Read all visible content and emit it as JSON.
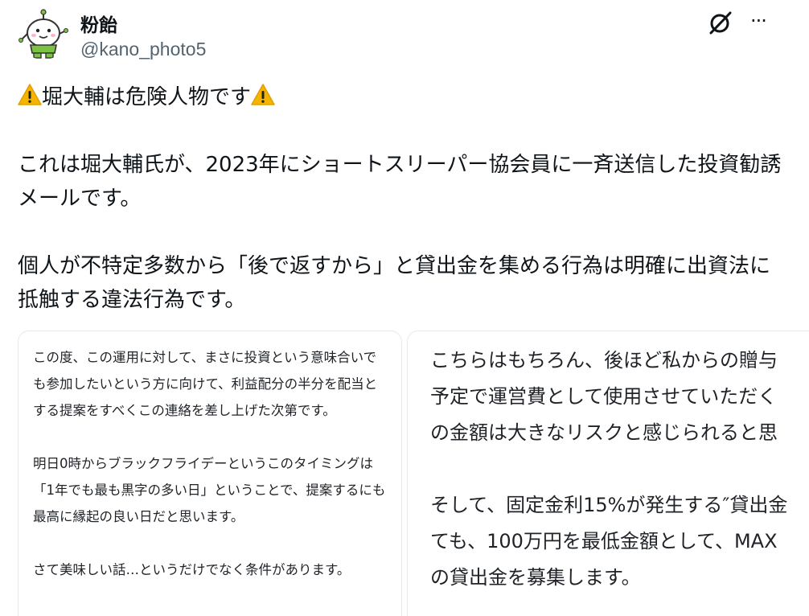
{
  "user": {
    "display_name": "粉飴",
    "handle": "@kano_photo5"
  },
  "actions": {
    "grok_icon": "grok-icon",
    "more_icon": "more-icon",
    "more_glyph": "···"
  },
  "tweet": {
    "line1": "堀大輔は危険人物です",
    "para2": "これは堀大輔氏が、2023年にショートスリーパー協会員に一斉送信した投資勧誘メールです。",
    "para3": "個人が不特定多数から「後で返すから」と貸出金を集める行為は明確に出資法に抵触する違法行為です。"
  },
  "image_left": {
    "p1": "この度、この運用に対して、まさに投資という意味合いでも参加したいという方に向けて、利益配分の半分を配当とする提案をすべくこの連絡を差し上げた次第です。",
    "p2": "明日0時からブラックフライデーというこのタイミングは「1年でも最も黒字の多い日」ということで、提案するにも最高に縁起の良い日だと思います。",
    "p3": "さて美味しい話…というだけでなく条件があります。"
  },
  "image_right": {
    "l1": "こちらはもちろん、後ほど私からの贈与",
    "l2": "予定で運営費として使用させていただく",
    "l3": "の金額は大きなリスクと感じられると思",
    "l4": "そして、固定金利15%が発生する″貸出金",
    "l5": "ても、100万円を最低金額として、MAX",
    "l6": "の貸出金を募集します。"
  },
  "colors": {
    "text": "#0f1419",
    "secondary": "#536471",
    "warning": "#f4b400",
    "avatar_green": "#7cc242"
  }
}
